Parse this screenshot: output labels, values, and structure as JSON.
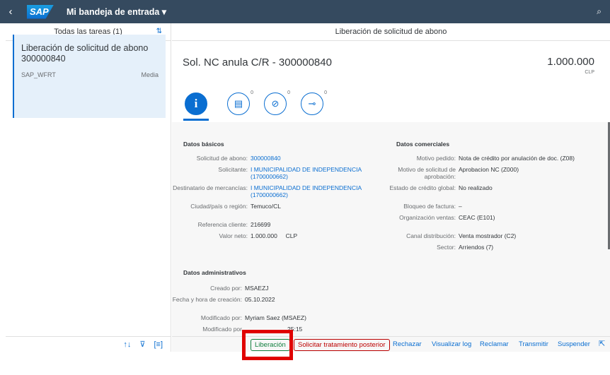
{
  "shell": {
    "title": "Mi bandeja de entrada ▾",
    "logo": "SAP"
  },
  "master": {
    "header": "Todas las tareas (1)",
    "search_value": "300000840",
    "item": {
      "title": "Liberación de solicitud de abono 300000840",
      "sub_left": "SAP_WFRT",
      "sub_right": "Media"
    }
  },
  "detail": {
    "header": "Liberación de solicitud de abono",
    "object_title": "Sol. NC anula C/R - 300000840",
    "amount": "1.000.000",
    "currency": "CLP",
    "tab_counts": [
      "0",
      "0",
      "0"
    ],
    "basic": {
      "title": "Datos básicos",
      "rows": [
        {
          "label": "Solicitud de abono:",
          "value": "300000840"
        },
        {
          "label": "Solicitante:",
          "value": "I MUNICIPALIDAD DE INDEPENDENCIA (1700000662)"
        },
        {
          "label": "Destinatario de mercancías:",
          "value": "I MUNICIPALIDAD DE INDEPENDENCIA (1700000662)"
        },
        {
          "label": "Ciudad/país o región:",
          "value": "Temuco/CL"
        },
        {
          "label": "Referencia cliente:",
          "value": "216699"
        },
        {
          "label": "Valor neto:",
          "value": "1.000.000     CLP"
        }
      ]
    },
    "commercial": {
      "title": "Datos comerciales",
      "rows": [
        {
          "label": "Motivo pedido:",
          "value": "Nota de crédito por anulación de doc. (Z08)"
        },
        {
          "label": "Motivo de solicitud de aprobación:",
          "value": "Aprobacion NC (Z000)"
        },
        {
          "label": "Estado de crédito global:",
          "value": "No realizado"
        },
        {
          "label": "Bloqueo de factura:",
          "value": "–"
        },
        {
          "label": "Organización ventas:",
          "value": "CEAC (E101)"
        },
        {
          "label": "Canal distribución:",
          "value": "Venta mostrador (C2)"
        },
        {
          "label": "Sector:",
          "value": "Arriendos (7)"
        }
      ]
    },
    "admin": {
      "title": "Datos administrativos",
      "rows": [
        {
          "label": "Creado por:",
          "value": "MSAEZJ"
        },
        {
          "label": "Fecha y hora de creación:",
          "value": "05.10.2022"
        },
        {
          "label": "Modificado por:",
          "value": "Myriam Saez (MSAEZ)"
        },
        {
          "label": "Modificado por",
          "value": "25:15"
        }
      ]
    }
  },
  "toolbar": {
    "liberacion": "Liberación",
    "solicitar": "Solicitar tratamiento posterior",
    "rechazar": "Rechazar",
    "log": "Visualizar log",
    "reclamar": "Reclamar",
    "transmitir": "Transmitir",
    "suspender": "Suspender"
  },
  "colors": {
    "shell": "#354a5f",
    "accent": "#0a6ed1",
    "highlight": "#e00000"
  }
}
